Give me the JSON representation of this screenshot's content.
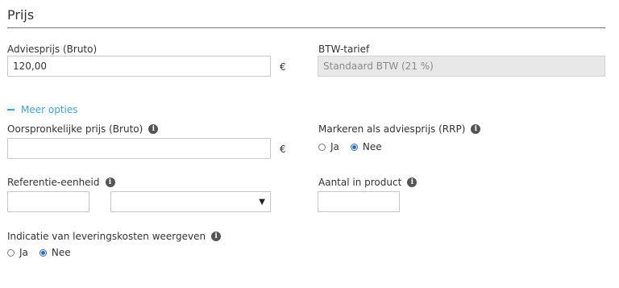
{
  "section": {
    "title": "Prijs"
  },
  "advice_price": {
    "label": "Adviesprijs (Bruto)",
    "value": "120,00",
    "currency": "€"
  },
  "vat": {
    "label": "BTW-tarief",
    "value": "Standaard BTW (21 %)"
  },
  "more_options": {
    "label": "Meer opties"
  },
  "original_price": {
    "label": "Oorspronkelijke prijs (Bruto)",
    "value": "",
    "currency": "€"
  },
  "mark_rrp": {
    "label": "Markeren als adviesprijs (RRP)",
    "options": [
      {
        "label": "Ja",
        "checked": false
      },
      {
        "label": "Nee",
        "checked": true
      }
    ]
  },
  "reference_unit": {
    "label": "Referentie-eenheid",
    "value": "",
    "select_value": "",
    "dropdown_glyph": "▼"
  },
  "amount_in_product": {
    "label": "Aantal in product",
    "value": ""
  },
  "delivery_costs": {
    "label": "Indicatie van leveringskosten weergeven",
    "options": [
      {
        "label": "Ja",
        "checked": false
      },
      {
        "label": "Nee",
        "checked": true
      }
    ]
  },
  "icons": {
    "info": "info-icon",
    "collapse": "minus-icon",
    "dropdown": "chevron-down-icon"
  },
  "colors": {
    "link": "#3aa3d6",
    "radio_checked": "#2a6bd6",
    "disabled_bg": "#e8e8e8"
  }
}
